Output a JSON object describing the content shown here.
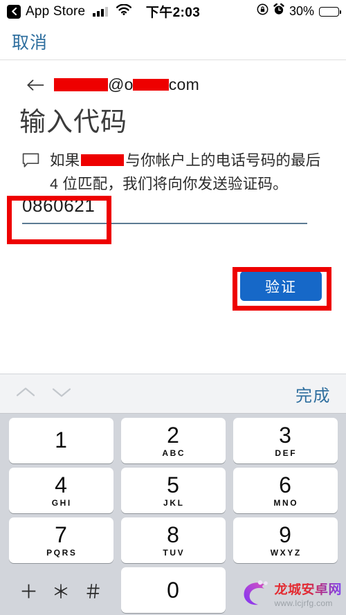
{
  "status_bar": {
    "back_app_label": "App Store",
    "back_icon": "chevron-left-icon",
    "signal_icon": "cellular-signal-icon",
    "signal_bars_filled": 3,
    "signal_bars_total": 4,
    "wifi_icon": "wifi-icon",
    "time": "下午2:03",
    "rotation_lock_icon": "rotation-lock-icon",
    "alarm_icon": "alarm-clock-icon",
    "battery_percent": "30%",
    "battery_level": 30,
    "battery_icon": "battery-icon"
  },
  "nav": {
    "cancel_label": "取消"
  },
  "account": {
    "back_icon": "arrow-left-icon",
    "email_redacted_user": "",
    "email_domain_prefix": "@o",
    "email_redacted_domain": "",
    "email_domain_suffix": "com"
  },
  "page": {
    "title": "输入代码",
    "note_icon": "message-bubble-icon",
    "note_text_before": "如果",
    "note_text_after": "与你帐户上的电话号码的最后 4 位匹配，我们将向你发送验证码。",
    "code_value": "0860621",
    "verify_label": "验证"
  },
  "annotations": {
    "color": "#ee0000",
    "boxes": [
      "code-input-highlight",
      "verify-button-highlight"
    ]
  },
  "keyboard": {
    "accessory": {
      "prev_icon": "chevron-up-icon",
      "next_icon": "chevron-down-icon",
      "done_label": "完成"
    },
    "rows": [
      [
        {
          "num": "1",
          "sub": ""
        },
        {
          "num": "2",
          "sub": "ABC"
        },
        {
          "num": "3",
          "sub": "DEF"
        }
      ],
      [
        {
          "num": "4",
          "sub": "GHI"
        },
        {
          "num": "5",
          "sub": "JKL"
        },
        {
          "num": "6",
          "sub": "MNO"
        }
      ],
      [
        {
          "num": "7",
          "sub": "PQRS"
        },
        {
          "num": "8",
          "sub": "TUV"
        },
        {
          "num": "9",
          "sub": "WXYZ"
        }
      ]
    ],
    "symbol_key": "＋ ＊ ＃",
    "zero_key": "0"
  },
  "watermark": {
    "site_name": "龙城安卓网",
    "site_url": "www.lcjrfg.com",
    "logo_icon": "dragon-c-logo-icon"
  }
}
